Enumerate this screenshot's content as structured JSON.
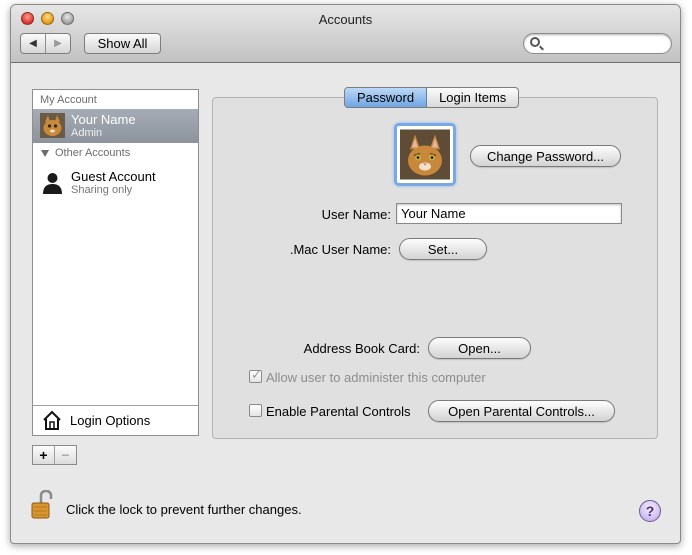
{
  "window": {
    "title": "Accounts"
  },
  "toolbar": {
    "back_glyph": "◀",
    "forward_glyph": "▶",
    "show_all_label": "Show All",
    "search_placeholder": ""
  },
  "sidebar": {
    "my_account_header": "My Account",
    "my_account": {
      "name": "Your Name",
      "role": "Admin"
    },
    "other_accounts_header": "Other Accounts",
    "guest": {
      "name": "Guest Account",
      "role": "Sharing only"
    },
    "login_options_label": "Login Options",
    "add_glyph": "+",
    "remove_glyph": "−"
  },
  "tabs": [
    {
      "label": "Password",
      "active": true
    },
    {
      "label": "Login Items",
      "active": false
    }
  ],
  "password_panel": {
    "change_password_label": "Change Password...",
    "user_name_label": "User Name:",
    "user_name_value": "Your Name",
    "mac_user_name_label": ".Mac User Name:",
    "set_label": "Set...",
    "address_book_label": "Address Book Card:",
    "open_label": "Open...",
    "allow_admin_label": "Allow user to administer this computer",
    "allow_admin_checked": true,
    "parental_label": "Enable Parental Controls",
    "parental_checked": false,
    "open_parental_label": "Open Parental Controls..."
  },
  "footer": {
    "lock_text": "Click the lock to prevent further changes.",
    "help_glyph": "?"
  },
  "icons": {
    "cat_photo": "cat-photo-icon",
    "guest": "person-silhouette-icon",
    "house": "house-icon",
    "lock": "open-lock-icon",
    "help": "help-icon",
    "search": "magnifier-icon"
  }
}
